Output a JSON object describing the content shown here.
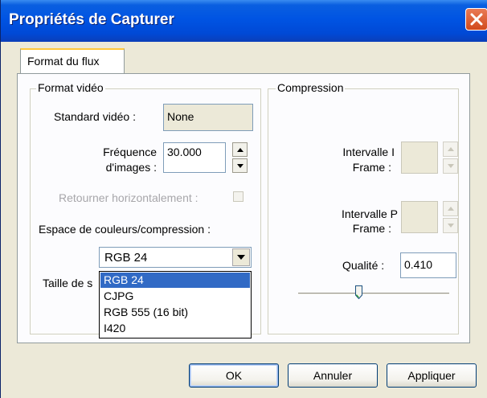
{
  "window": {
    "title": "Propriétés de Capturer",
    "close_icon": "close-icon"
  },
  "tabs": [
    {
      "label": "Format du flux",
      "selected": true
    }
  ],
  "video_format": {
    "legend": "Format vidéo",
    "standard_label": "Standard vidéo :",
    "standard_value": "None",
    "frequency_label_1": "Fréquence",
    "frequency_label_2": "d'images :",
    "frequency_value": "30.000",
    "flip_label": "Retourner horizontalement :",
    "flip_checked": false,
    "colorspace_label": "Espace de couleurs/compression :",
    "colorspace_value": "RGB 24",
    "size_label": "Taille de s",
    "colorspace_options": [
      "RGB 24",
      "CJPG",
      "RGB 555 (16 bit)",
      "I420"
    ],
    "colorspace_selected_index": 0
  },
  "compression": {
    "legend": "Compression",
    "iframe_label_1": "Intervalle I",
    "iframe_label_2": "Frame :",
    "pframe_label_1": "Intervalle P",
    "pframe_label_2": "Frame :",
    "quality_label": "Qualité :",
    "quality_value": "0.410",
    "quality_slider_fraction": 0.41
  },
  "buttons": {
    "ok": "OK",
    "cancel": "Annuler",
    "apply": "Appliquer"
  },
  "colors": {
    "titlebar": "#0054e3",
    "selection": "#316ac5",
    "close": "#d14a1c"
  }
}
